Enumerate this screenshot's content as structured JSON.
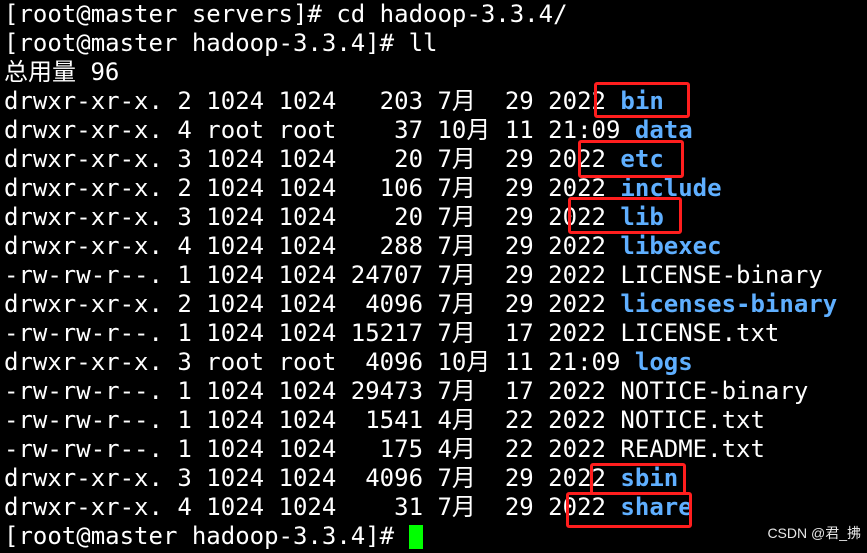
{
  "terminal": {
    "lines": [
      {
        "prefix": "[root@master servers]# cd hadoop-3.3.4/",
        "name": ""
      },
      {
        "prefix": "[root@master hadoop-3.3.4]# ll",
        "name": ""
      },
      {
        "prefix": "总用量 96",
        "name": ""
      },
      {
        "prefix": "drwxr-xr-x. 2 1024 1024   203 7月  29 2022 ",
        "name": "bin",
        "is_dir": true
      },
      {
        "prefix": "drwxr-xr-x. 4 root root    37 10月 11 21:09 ",
        "name": "data",
        "is_dir": true
      },
      {
        "prefix": "drwxr-xr-x. 3 1024 1024    20 7月  29 2022 ",
        "name": "etc",
        "is_dir": true
      },
      {
        "prefix": "drwxr-xr-x. 2 1024 1024   106 7月  29 2022 ",
        "name": "include",
        "is_dir": true
      },
      {
        "prefix": "drwxr-xr-x. 3 1024 1024    20 7月  29 2022 ",
        "name": "lib",
        "is_dir": true
      },
      {
        "prefix": "drwxr-xr-x. 4 1024 1024   288 7月  29 2022 ",
        "name": "libexec",
        "is_dir": true
      },
      {
        "prefix": "-rw-rw-r--. 1 1024 1024 24707 7月  29 2022 ",
        "name": "LICENSE-binary",
        "is_dir": false
      },
      {
        "prefix": "drwxr-xr-x. 2 1024 1024  4096 7月  29 2022 ",
        "name": "licenses-binary",
        "is_dir": true
      },
      {
        "prefix": "-rw-rw-r--. 1 1024 1024 15217 7月  17 2022 ",
        "name": "LICENSE.txt",
        "is_dir": false
      },
      {
        "prefix": "drwxr-xr-x. 3 root root  4096 10月 11 21:09 ",
        "name": "logs",
        "is_dir": true
      },
      {
        "prefix": "-rw-rw-r--. 1 1024 1024 29473 7月  17 2022 ",
        "name": "NOTICE-binary",
        "is_dir": false
      },
      {
        "prefix": "-rw-rw-r--. 1 1024 1024  1541 4月  22 2022 ",
        "name": "NOTICE.txt",
        "is_dir": false
      },
      {
        "prefix": "-rw-rw-r--. 1 1024 1024   175 4月  22 2022 ",
        "name": "README.txt",
        "is_dir": false
      },
      {
        "prefix": "drwxr-xr-x. 3 1024 1024  4096 7月  29 2022 ",
        "name": "sbin",
        "is_dir": true
      },
      {
        "prefix": "drwxr-xr-x. 4 1024 1024    31 7月  29 2022 ",
        "name": "share",
        "is_dir": true
      },
      {
        "prefix": "[root@master hadoop-3.3.4]# ",
        "name": ""
      }
    ]
  },
  "watermark": "CSDN @君_拂",
  "colors": {
    "background": "#000000",
    "text": "#ffffff",
    "directory": "#5fafff",
    "cursor": "#00ff00",
    "highlight_box": "#ff1e1e"
  }
}
